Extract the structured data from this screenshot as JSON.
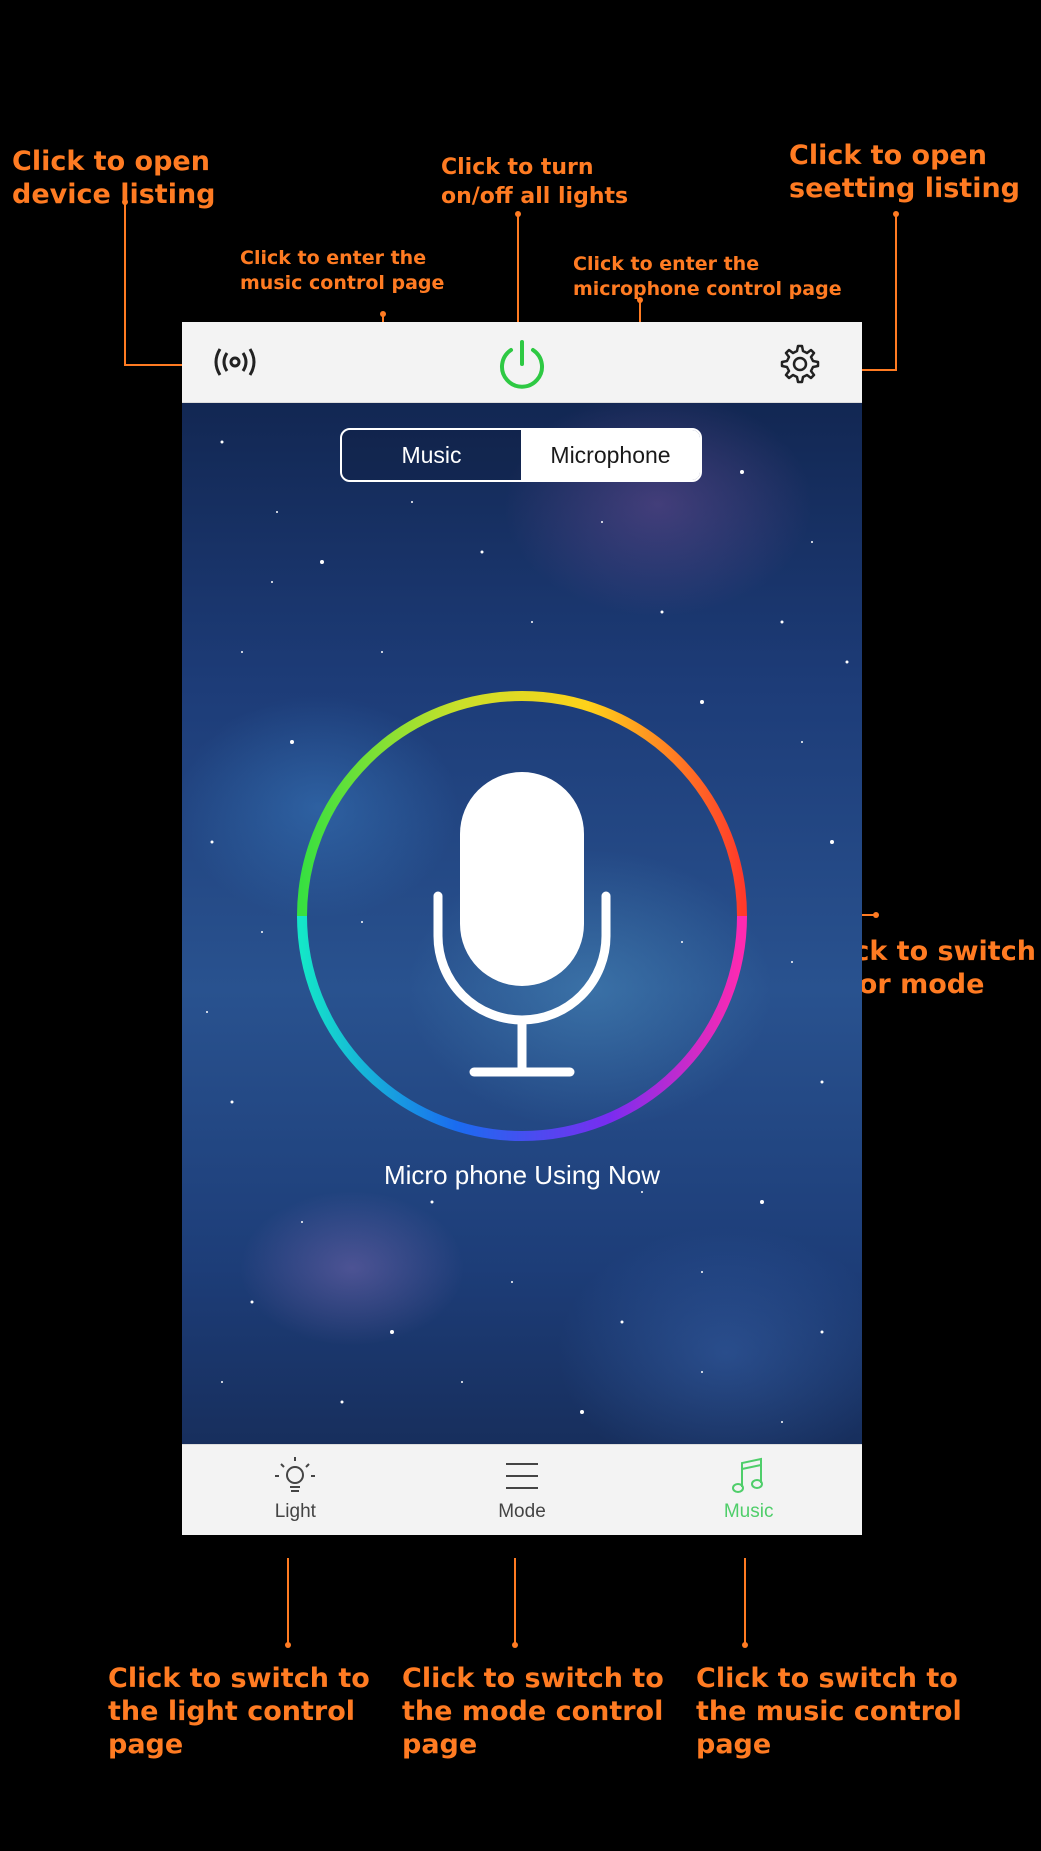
{
  "annotations": {
    "device_listing": "Click to open\ndevice listing",
    "power_all": "Click to turn\non/off all lights",
    "settings_listing": "Click to open\nseetting listing",
    "music_page": "Click to enter the\nmusic control page",
    "microphone_page": "Click to enter the\nmicrophone control page",
    "color_mode": "Click to switch\ncolor mode",
    "light_tab": "Click to switch to\nthe light control\npage",
    "mode_tab": "Click to switch to\nthe mode control\npage",
    "music_tab": "Click to switch to\nthe music control\npage"
  },
  "topbar": {
    "device_icon": "broadcast-icon",
    "power_icon": "power-icon",
    "settings_icon": "gear-icon",
    "power_color": "#2ec943"
  },
  "segment": {
    "left_label": "Music",
    "right_label": "Microphone",
    "selected": "Microphone"
  },
  "main": {
    "center_icon": "microphone-icon",
    "ring": "rainbow-color-ring",
    "status_text": "Micro phone Using Now"
  },
  "tabbar": {
    "items": [
      {
        "label": "Light",
        "icon": "bulb-icon",
        "active": false
      },
      {
        "label": "Mode",
        "icon": "menu-lines-icon",
        "active": false
      },
      {
        "label": "Music",
        "icon": "music-note-icon",
        "active": true
      }
    ],
    "active_color": "#4fce6a"
  },
  "colors": {
    "annotation": "#ff7b22",
    "background": "#000000"
  }
}
